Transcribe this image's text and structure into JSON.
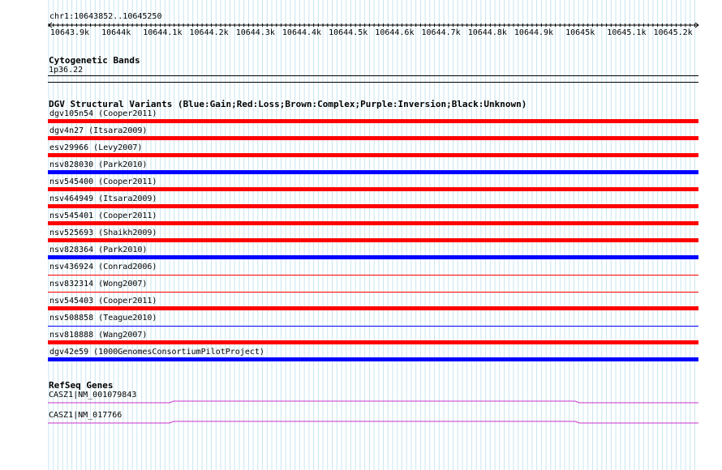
{
  "ruler": {
    "range_label": "chr1:10643852..10645250",
    "ticks": [
      "10643.9k",
      "10644k",
      "10644.1k",
      "10644.2k",
      "10644.3k",
      "10644.4k",
      "10644.5k",
      "10644.6k",
      "10644.7k",
      "10644.8k",
      "10644.9k",
      "10645k",
      "10645.1k",
      "10645.2k"
    ]
  },
  "cytoband": {
    "title": "Cytogenetic Bands",
    "band_label": "1p36.22"
  },
  "dgv": {
    "title": "DGV Structural Variants (Blue:Gain;Red:Loss;Brown:Complex;Purple:Inversion;Black:Unknown)",
    "colors": {
      "loss": "#ff0000",
      "gain": "#0000ff"
    },
    "variants": [
      {
        "label": "dgv105n54 (Cooper2011)",
        "type": "loss",
        "weight": "thick"
      },
      {
        "label": "dgv4n27 (Itsara2009)",
        "type": "loss",
        "weight": "thick"
      },
      {
        "label": "esv29966 (Levy2007)",
        "type": "loss",
        "weight": "thick"
      },
      {
        "label": "nsv828030 (Park2010)",
        "type": "gain",
        "weight": "thick"
      },
      {
        "label": "nsv545400 (Cooper2011)",
        "type": "loss",
        "weight": "thick"
      },
      {
        "label": "nsv464949 (Itsara2009)",
        "type": "loss",
        "weight": "thick"
      },
      {
        "label": "nsv545401 (Cooper2011)",
        "type": "loss",
        "weight": "thick"
      },
      {
        "label": "nsv525693 (Shaikh2009)",
        "type": "loss",
        "weight": "thick"
      },
      {
        "label": "nsv828364 (Park2010)",
        "type": "gain",
        "weight": "thick"
      },
      {
        "label": "nsv436924 (Conrad2006)",
        "type": "loss",
        "weight": "thin"
      },
      {
        "label": "nsv832314 (Wong2007)",
        "type": "loss",
        "weight": "thin"
      },
      {
        "label": "nsv545403 (Cooper2011)",
        "type": "loss",
        "weight": "thick"
      },
      {
        "label": "nsv508858 (Teague2010)",
        "type": "gain",
        "weight": "thin"
      },
      {
        "label": "nsv818888 (Wang2007)",
        "type": "loss",
        "weight": "thick"
      },
      {
        "label": "dgv42e59 (1000GenomesConsortiumPilotProject)",
        "type": "gain",
        "weight": "thick"
      }
    ]
  },
  "refseq": {
    "title": "RefSeq Genes",
    "line_color": "#cc33cc",
    "genes": [
      {
        "label": "CASZ1|NM_001079843"
      },
      {
        "label": "CASZ1|NM_017766"
      }
    ]
  }
}
